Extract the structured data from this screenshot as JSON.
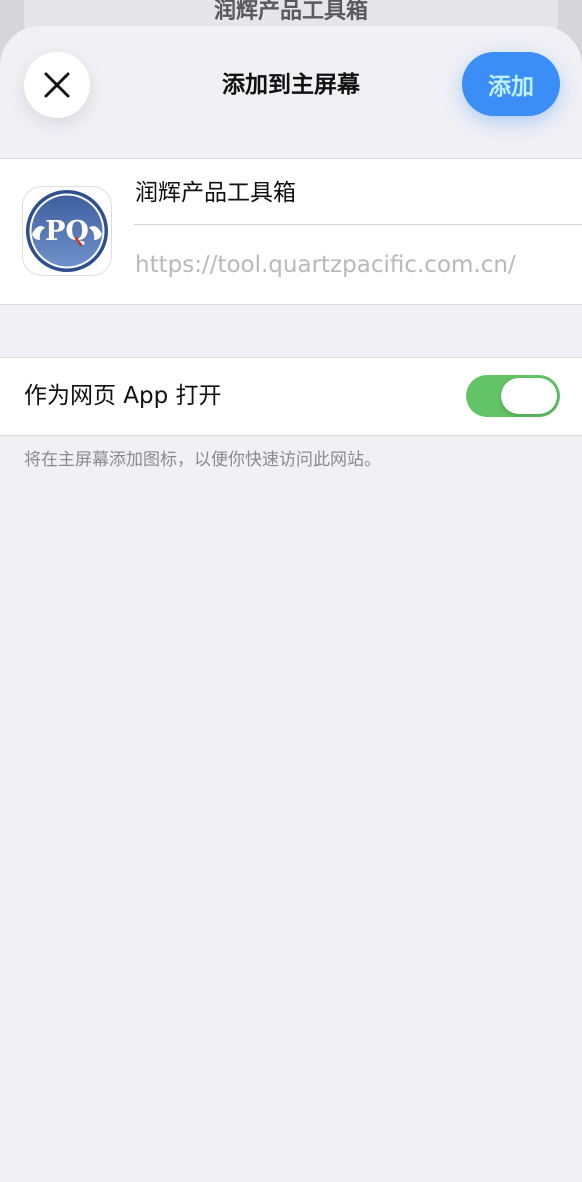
{
  "backdrop": {
    "title": "润辉产品工具箱"
  },
  "header": {
    "close_icon": "close-icon",
    "title": "添加到主屏幕",
    "add_label": "添加",
    "accent_color": "#3a8ef6"
  },
  "app_info": {
    "icon": "pq-logo-icon",
    "icon_text": "PQ",
    "name": "润辉产品工具箱",
    "url": "https://tool.quartzpacific.com.cn/"
  },
  "web_app_toggle": {
    "label": "作为网页 App 打开",
    "state": "on",
    "on_color": "#62c466"
  },
  "footnote": "将在主屏幕添加图标，以便你快速访问此网站。"
}
